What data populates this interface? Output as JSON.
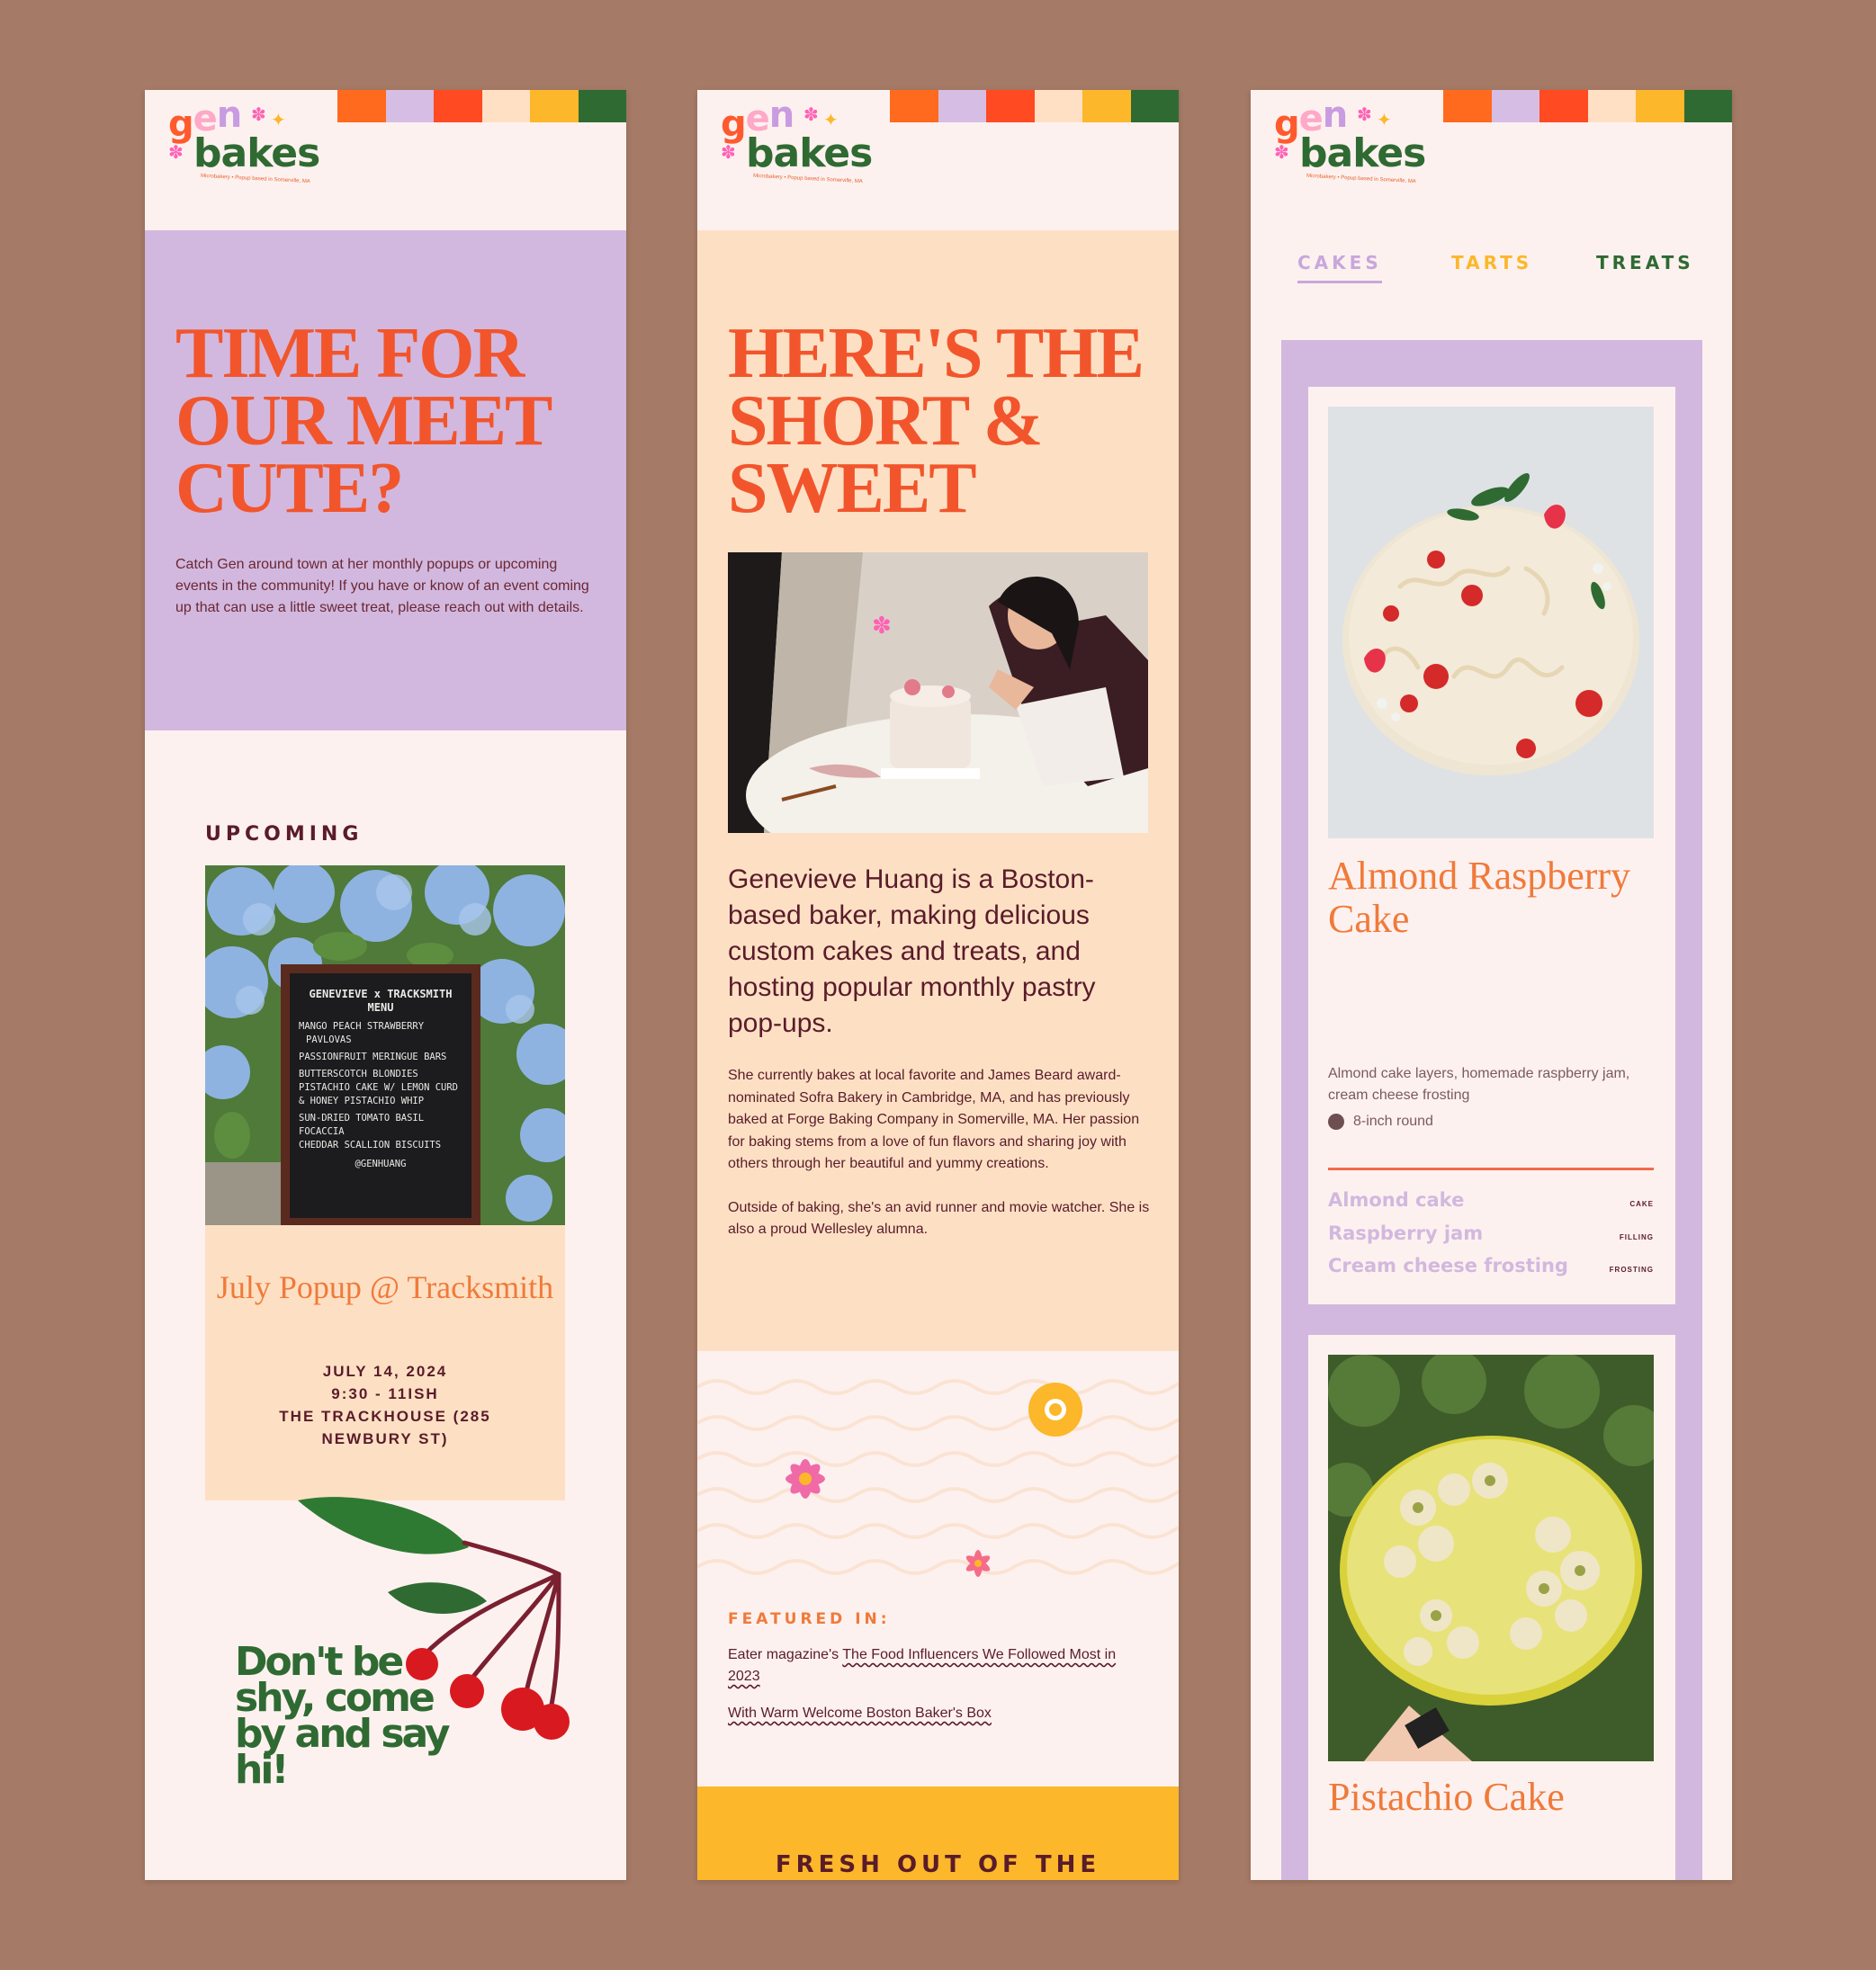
{
  "brand": {
    "logo_gen": {
      "g": "g",
      "e": "e",
      "n": "n"
    },
    "logo_bakes": "bakes",
    "tagline": "Microbakery • Popup based in Somerville, MA",
    "stripe_colors": [
      "#ff6a1f",
      "#d6bde4",
      "#ff4a22",
      "#ffe0c4",
      "#fcb72a",
      "#2f6a32"
    ]
  },
  "panel1": {
    "hero_title": "TIME FOR OUR MEET CUTE?",
    "hero_body": "Catch Gen around town at her monthly popups or upcoming events in the community! If you have or know of an event coming up that can use a little sweet treat, please reach out with details.",
    "upcoming_label": "UPCOMING",
    "photo": {
      "sign_title": "GENEVIEVE x TRACKSMITH",
      "sign_subtitle": "MENU",
      "sign_items": [
        "MANGO PEACH STRAWBERRY",
        "PAVLOVAS",
        "PASSIONFRUIT MERINGUE BARS",
        "BUTTERSCOTCH BLONDIES",
        "PISTACHIO CAKE W/ LEMON CURD",
        "& HONEY PISTACHIO WHIP",
        "SUN-DRIED TOMATO BASIL FOCACCIA",
        "CHEDDAR SCALLION BISCUITS"
      ],
      "sign_handle": "@GENHUANG"
    },
    "event": {
      "title": "July Popup @ Tracksmith",
      "date": "JULY 14, 2024",
      "time": "9:30 - 11ISH",
      "location": "THE TRACKHOUSE (285 NEWBURY ST)"
    },
    "cta": "Don't be shy, come by and say hi!"
  },
  "panel2": {
    "hero_title": "HERE'S THE SHORT & SWEET",
    "lead": "Genevieve Huang is a Boston-based baker, making delicious custom cakes and treats, and hosting popular monthly pastry pop-ups.",
    "body_1": "She currently bakes at local favorite and James Beard award-nominated Sofra Bakery in Cambridge, MA, and has previously baked at Forge Baking Company in Somerville, MA. Her passion for baking stems from a love of fun flavors and sharing joy with others through her beautiful and yummy creations.",
    "body_2": "Outside of baking, she's an avid runner and movie watcher. She is also a proud Wellesley alumna.",
    "featured_label": "FEATURED IN:",
    "featured": [
      {
        "prefix": "Eater magazine's ",
        "link": "The Food Influencers We Followed Most in 2023"
      },
      {
        "prefix": "",
        "link": "With Warm Welcome Boston Baker's Box"
      }
    ],
    "fresh_label": "FRESH OUT OF THE"
  },
  "panel3": {
    "tabs": [
      {
        "label": "CAKES",
        "color": "#c8a7dc",
        "active": true
      },
      {
        "label": "TARTS",
        "color": "#fcb72a",
        "active": false
      },
      {
        "label": "TREATS",
        "color": "#2f6a32",
        "active": false
      }
    ],
    "products": [
      {
        "name": "Almond Raspberry Cake",
        "description": "Almond cake layers, homemade raspberry jam, cream cheese frosting",
        "size": "8-inch round",
        "ingredients": [
          {
            "name": "Almond cake",
            "type": "CAKE"
          },
          {
            "name": "Raspberry jam",
            "type": "FILLING"
          },
          {
            "name": "Cream cheese frosting",
            "type": "FROSTING"
          }
        ]
      },
      {
        "name": "Pistachio Cake"
      }
    ]
  },
  "colors": {
    "background": "#a57a66",
    "page": "#fdf1ef",
    "lavender": "#d2b8de",
    "peach": "#fde0c4",
    "tomato": "#f2552c",
    "orange": "#f07a3a",
    "maroon": "#5a1b2a",
    "green": "#2f6a32",
    "yellow": "#fcb72a"
  }
}
